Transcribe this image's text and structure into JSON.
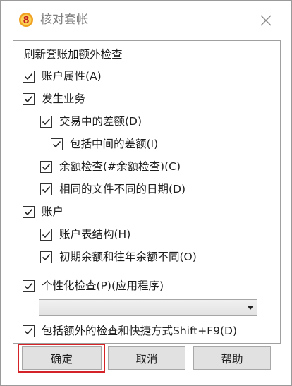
{
  "window": {
    "title": "核对套帐",
    "app_icon_digit": "8"
  },
  "dialog": {
    "heading": "刷新套账加额外检查",
    "options": [
      {
        "key": "acct_props",
        "label": "账户属性(A)",
        "checked": true
      },
      {
        "key": "txn",
        "label": "发生业务",
        "checked": true
      },
      {
        "key": "txn_diff",
        "label": "交易中的差额(D)",
        "checked": true
      },
      {
        "key": "mid_diff",
        "label": "包括中间的差额(I)",
        "checked": true
      },
      {
        "key": "bal_check",
        "label": "余额检查(#余额检查)(C)",
        "checked": true
      },
      {
        "key": "same_file_date",
        "label": "相同的文件不同的日期(D)",
        "checked": true
      },
      {
        "key": "accounts",
        "label": "账户",
        "checked": true
      },
      {
        "key": "acct_struct",
        "label": "账户表结构(H)",
        "checked": true
      },
      {
        "key": "opening_bal",
        "label": "初期余额和往年余额不同(O)",
        "checked": true
      },
      {
        "key": "custom_check",
        "label": "个性化检查(P)(应用程序)",
        "checked": true
      },
      {
        "key": "extra_shortcut",
        "label": "包括额外的检查和快捷方式Shift+F9(D)",
        "checked": true
      }
    ],
    "dropdown": {
      "selected": ""
    }
  },
  "buttons": {
    "ok": "确定",
    "cancel": "取消",
    "help": "帮助"
  },
  "colors": {
    "highlight": "#d5232a",
    "icon_bg": "#f0a020",
    "icon_fg": "#c0191f"
  }
}
